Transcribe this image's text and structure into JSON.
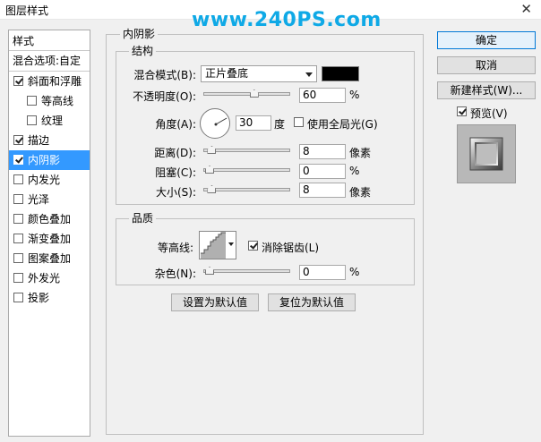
{
  "window": {
    "title": "图层样式",
    "close_glyph": "✕"
  },
  "watermark": "www.240PS.com",
  "style_list": {
    "header": "样式",
    "blend_options": "混合选项:自定",
    "items": [
      {
        "label": "斜面和浮雕",
        "checked": true,
        "indent": false
      },
      {
        "label": "等高线",
        "checked": false,
        "indent": true
      },
      {
        "label": "纹理",
        "checked": false,
        "indent": true
      },
      {
        "label": "描边",
        "checked": true,
        "indent": false
      },
      {
        "label": "内阴影",
        "checked": true,
        "indent": false,
        "selected": true
      },
      {
        "label": "内发光",
        "checked": false,
        "indent": false
      },
      {
        "label": "光泽",
        "checked": false,
        "indent": false
      },
      {
        "label": "颜色叠加",
        "checked": false,
        "indent": false
      },
      {
        "label": "渐变叠加",
        "checked": false,
        "indent": false
      },
      {
        "label": "图案叠加",
        "checked": false,
        "indent": false
      },
      {
        "label": "外发光",
        "checked": false,
        "indent": false
      },
      {
        "label": "投影",
        "checked": false,
        "indent": false
      }
    ]
  },
  "panel": {
    "title": "内阴影",
    "structure": {
      "title": "结构",
      "blend_mode_label": "混合模式(B):",
      "blend_mode_value": "正片叠底",
      "color": "#000000",
      "opacity_label": "不透明度(O):",
      "opacity_value": "60",
      "opacity_fraction": 0.6,
      "opacity_unit": "%",
      "angle_label": "角度(A):",
      "angle_value": "30",
      "angle_degrees": 30,
      "angle_unit": "度",
      "global_light_label": "使用全局光(G)",
      "global_light_checked": false,
      "distance_label": "距离(D):",
      "distance_value": "8",
      "distance_fraction": 0.03,
      "distance_unit": "像素",
      "choke_label": "阻塞(C):",
      "choke_value": "0",
      "choke_fraction": 0.0,
      "choke_unit": "%",
      "size_label": "大小(S):",
      "size_value": "8",
      "size_fraction": 0.03,
      "size_unit": "像素"
    },
    "quality": {
      "title": "品质",
      "contour_label": "等高线:",
      "antialias_label": "消除锯齿(L)",
      "antialias_checked": true,
      "noise_label": "杂色(N):",
      "noise_value": "0",
      "noise_fraction": 0.0,
      "noise_unit": "%"
    },
    "make_default": "设置为默认值",
    "reset_default": "复位为默认值"
  },
  "buttons": {
    "ok": "确定",
    "cancel": "取消",
    "new_style": "新建样式(W)...",
    "preview_label": "预览(V)",
    "preview_checked": true
  },
  "colors": {
    "selection": "#3399ff",
    "default_button_border": "#0078d7"
  }
}
